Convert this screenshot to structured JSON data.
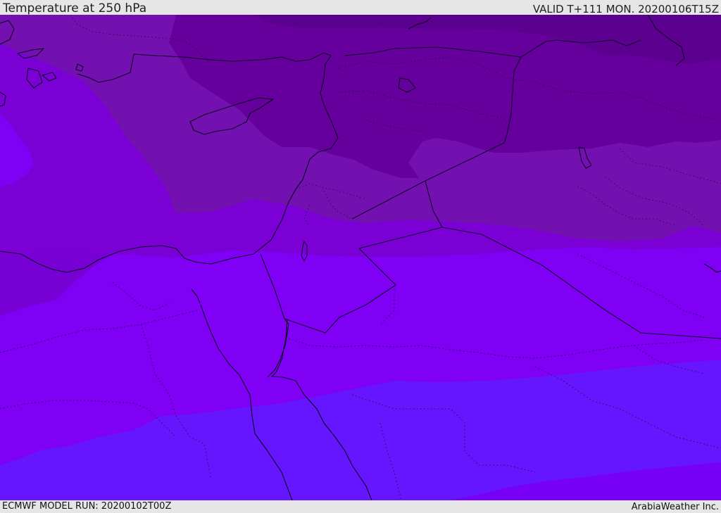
{
  "header": {
    "title": "Temperature at 250 hPa",
    "valid": "VALID T+111 MON. 20200106T15Z"
  },
  "footer": {
    "model_run": "ECMWF MODEL RUN: 20200102T00Z",
    "credit": "ArabiaWeather Inc."
  },
  "colors": {
    "band_coldest": "#5c0090",
    "band_cold": "#66009d",
    "band_mid_cold": "#7311b0",
    "band_mid": "#7b00d6",
    "band_bright": "#7f00f5",
    "band_blue": "#6615ff",
    "band_blue_lower": "#6a0bff",
    "band_bottom": "#7800f8",
    "coastline": "#0b0820"
  },
  "icons": {
    "map": "weather-map-icon"
  }
}
